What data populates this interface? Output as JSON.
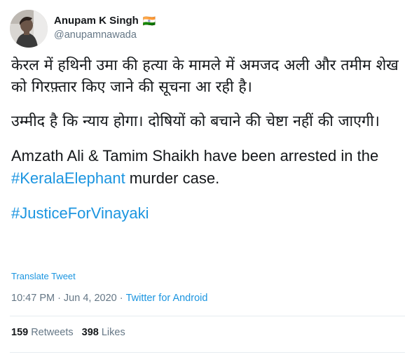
{
  "author": {
    "name": "Anupam K Singh",
    "flag": "🇮🇳",
    "handle": "@anupamnawada",
    "avatar_icon": "profile-photo"
  },
  "tweet": {
    "hi_para1": "केरल में हथिनी उमा की हत्या के मामले में अमजद अली और तमीम शेख को गिरफ़्तार किए जाने की सूचना आ रही है।",
    "hi_para2": "उम्मीद है कि न्याय होगा। दोषियों को बचाने की चेष्टा नहीं की जाएगी।",
    "en_part1": "Amzath Ali & Tamim Shaikh have been arrested in the",
    "en_hashtag": "#KeralaElephant",
    "en_part2": " murder case.",
    "hashtag2": "#JusticeForVinayaki"
  },
  "translate_label": "Translate Tweet",
  "meta": {
    "time": "10:47 PM",
    "separator": "·",
    "date": "Jun 4, 2020",
    "source": "Twitter for Android"
  },
  "stats": {
    "retweets_count": "159",
    "retweets_label": "Retweets",
    "likes_count": "398",
    "likes_label": "Likes"
  },
  "colors": {
    "link": "#1b95e0",
    "secondary_text": "#657786",
    "primary_text": "#14171a",
    "divider": "#e6ecf0"
  }
}
